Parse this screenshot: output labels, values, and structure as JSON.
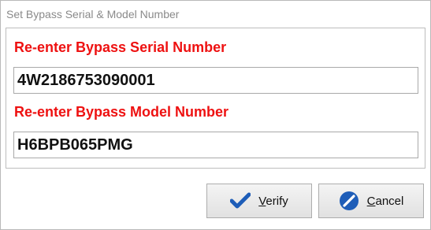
{
  "window": {
    "title": "Set Bypass Serial & Model Number"
  },
  "serial": {
    "label": "Re-enter Bypass Serial Number",
    "value": "4W2186753090001"
  },
  "model": {
    "label": "Re-enter Bypass Model Number",
    "value": "H6BPB065PMG"
  },
  "buttons": {
    "verify": {
      "mnemonic": "V",
      "rest": "erify",
      "icon": "checkmark-icon"
    },
    "cancel": {
      "mnemonic": "C",
      "rest": "ancel",
      "icon": "cancel-icon"
    }
  },
  "colors": {
    "label_red": "#ee1111",
    "icon_blue": "#1e5db8"
  }
}
